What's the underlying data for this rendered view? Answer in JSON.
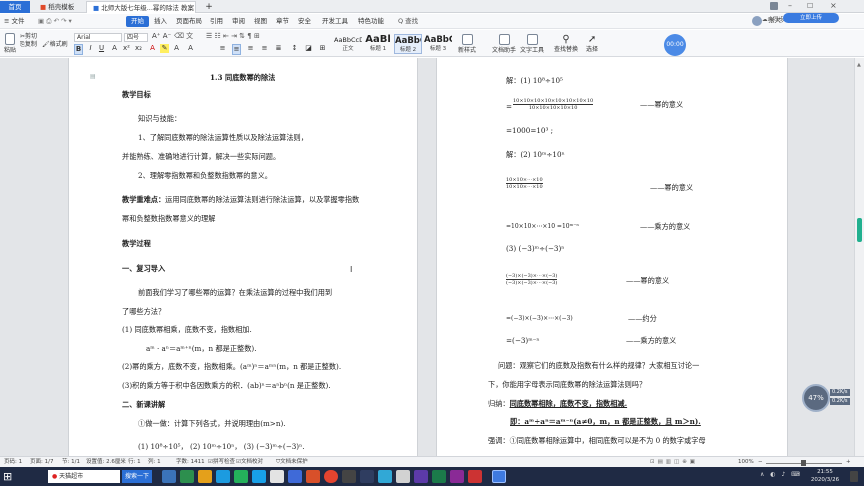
{
  "tabs": {
    "home": "首页",
    "t1": "稻壳模板",
    "t2": "北师大版七年级...幂的除法 教案",
    "close": "×",
    "add": "+"
  },
  "menu": {
    "file": "≡ 文件",
    "items": [
      "开始",
      "插入",
      "页面布局",
      "引用",
      "审阅",
      "视图",
      "章节",
      "安全",
      "开发工具",
      "特色功能"
    ],
    "search": "Q 查找",
    "user": "张大人188...",
    "sync": "未同步",
    "share": "协作",
    "hint": "立即上传"
  },
  "ribbon": {
    "paste": "粘贴",
    "cut": "剪切",
    "copy": "复制",
    "painter": "格式刷",
    "font": "Arial",
    "size": "四号",
    "styles": [
      {
        "preview": "AaBbCcD",
        "name": "正文"
      },
      {
        "preview": "AaBl",
        "name": "标题 1"
      },
      {
        "preview": "AaBbC",
        "name": "标题 2"
      },
      {
        "preview": "AaBbC",
        "name": "标题 3"
      }
    ],
    "newstyle": "新样式",
    "helper": "文档助手",
    "tools": "文字工具",
    "find": "查找替换",
    "select": "选择",
    "timer": "00:00"
  },
  "left": {
    "title": "1.3  同底数幂的除法",
    "h1": "教学目标",
    "p1": "知识与技能：",
    "p2": "1、了解同底数幂的除法运算性质以及除法运算法则，",
    "p3": "并能熟练、准确地进行计算，解决一些实际问题。",
    "p4": "2、理解零指数幂和负整数指数幂的意义。",
    "p5a": "教学重难点：",
    "p5b": "运用同底数幂的除法运算法则进行除法运算，以及掌握零指数",
    "p6": "幂和负整数指数幂意义的理解",
    "h2": "教学过程",
    "h3": "一、复习导入",
    "p7": "前面我们学习了哪些幂的运算？在乘法运算的过程中我们用到",
    "p8": "了哪些方法？",
    "p9": "(1) 同底数幂相乘，底数不变，指数相加.",
    "p10": "aᵐ · aⁿ＝aᵐ⁺ⁿ(m，n 都是正整数).",
    "p11": "(2)幂的乘方，底数不变，指数相乘。(aᵐ)ⁿ＝aᵐⁿ(m，n 都是正整数).",
    "p12": "(3)积的乘方等于积中各因数乘方的积．(ab)ⁿ＝aⁿbⁿ(n 是正整数).",
    "h4": "二、新课讲解",
    "p13": "①做一做：计算下列各式，并说明理由(m>n).",
    "p14": "(1) 10⁸÷10⁵，  (2) 10ᵐ÷10ⁿ，  (3) (−3)ᵐ÷(−3)ⁿ."
  },
  "right": {
    "r1": "解：(1) 10⁸÷10⁵",
    "r2eq": "=",
    "r2num": "10×10×10×10×10×10×10×10",
    "r2den": "10×10×10×10×10",
    "r2note": "——幂的意义",
    "r3": "=1000=10³ ;",
    "r4": "解：(2) 10ᵐ÷10ⁿ",
    "r5num": "10×10×⋯×10",
    "r5den": "10×10×⋯×10",
    "r5note": "——幂的意义",
    "r6": "=10×10×⋯×10 =10ᵐ⁻ⁿ",
    "r6note": "——乘方的意义",
    "r7": "(3) (−3)ᵐ÷(−3)ⁿ",
    "r8num": "(−3)×(−3)×⋯×(−3)",
    "r8den": "(−3)×(−3)×⋯×(−3)",
    "r8note": "——幂的意义",
    "r9": "=(−3)×(−3)×⋯×(−3)",
    "r9note": "——约分",
    "r10": "=(−3)ᵐ⁻ⁿ",
    "r10note": "——乘方的意义",
    "r11": "问题：观察它们的底数及指数有什么样的规律？大家相互讨论一",
    "r12": "下，你能用字母表示同底数幂的除法运算法则吗？",
    "r13a": "归纳：",
    "r13b": "同底数幂相除，底数不变，指数相减.",
    "r14": "即：aᵐ÷aⁿ＝aᵐ⁻ⁿ(a≠0，m，n 都是正整数，且 m＞n).",
    "r15": "强调：①同底数幂相除运算中，相同底数可以是不为 0 的数字或字母"
  },
  "status": {
    "page": "页码: 1",
    "pages": "页面: 1/7",
    "section": "节: 1/1",
    "pos": "设置值: 2.6厘米",
    "row": "行: 1",
    "col": "列: 1",
    "words": "字数: 1411",
    "spell": "拼写检查",
    "proof": "文档校对",
    "protect": "文档未保护",
    "zoom": "100%",
    "zoomminus": "−",
    "zoomplus": "+"
  },
  "taskbar": {
    "search": "天猫超市",
    "search2": "搜索一下",
    "time": "21:55",
    "date": "2020/3/26"
  },
  "widget": {
    "pct": "47%",
    "up": "0.2K/s",
    "down": "0.2K/s"
  }
}
